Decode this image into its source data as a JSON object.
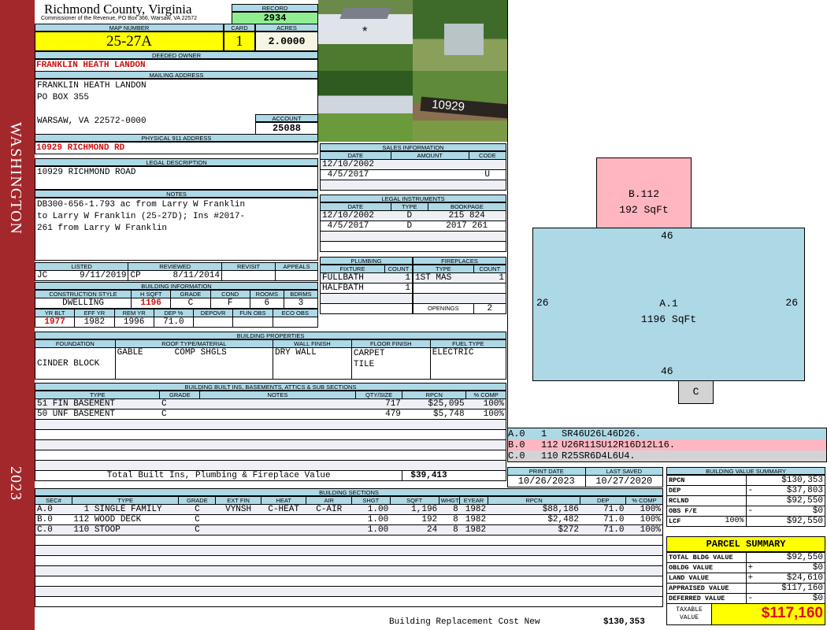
{
  "sidebar": {
    "district": "WASHINGTON",
    "year": "2023"
  },
  "header": {
    "title": "Richmond County, Virginia",
    "subtitle": "Commissioner of the Revenue, PO Box 366, Warsaw, VA 22572",
    "record_label": "RECORD",
    "record": "2934",
    "map_label": "MAP NUMBER",
    "map_number": "25-27A",
    "card_label": "CARD",
    "card": "1",
    "acres_label": "ACRES",
    "acres": "2.0000"
  },
  "owner": {
    "label": "DEEDED OWNER",
    "name": "FRANKLIN HEATH LANDON"
  },
  "mailing": {
    "label": "MAILING ADDRESS",
    "line1": "FRANKLIN HEATH LANDON",
    "line2": "PO BOX 355",
    "line3": "WARSAW, VA 22572-0000",
    "account_label": "ACCOUNT",
    "account": "25088"
  },
  "physical": {
    "label": "PHYSICAL 911 ADDRESS",
    "address": "10929 RICHMOND RD"
  },
  "legal": {
    "label": "LEGAL DESCRIPTION",
    "text": "10929 RICHMOND ROAD"
  },
  "notes": {
    "label": "NOTES",
    "text": "DB300-656-1.793 ac from Larry W Franklin\nto Larry W Franklin (25-27D); Ins #2017-\n261 from Larry W Franklin"
  },
  "photos": {
    "address_sign": "10929"
  },
  "sales": {
    "label": "SALES INFORMATION",
    "headers": [
      "DATE",
      "AMOUNT",
      "CODE"
    ],
    "rows": [
      [
        "12/10/2002",
        "",
        ""
      ],
      [
        " 4/5/2017",
        "",
        "U"
      ],
      [
        "",
        "",
        ""
      ]
    ]
  },
  "instruments": {
    "label": "LEGAL INSTRUMENTS",
    "headers": [
      "DATE",
      "TYPE",
      "BOOKPAGE"
    ],
    "rows": [
      [
        "12/10/2002",
        "D",
        "215 824"
      ],
      [
        " 4/5/2017",
        "D",
        "2017 261"
      ],
      [
        "",
        "",
        ""
      ],
      [
        "",
        "",
        ""
      ]
    ]
  },
  "review": {
    "headers": [
      "LISTED",
      "REVIEWED",
      "REVISIT",
      "APPEALS"
    ],
    "listed_by": "JC",
    "listed": "9/11/2019",
    "reviewed_by": "CP",
    "reviewed": "8/11/2014",
    "revisit": "",
    "appeals": ""
  },
  "building_info": {
    "label": "BUILDING INFORMATION",
    "headers1": [
      "CONSTRUCTION STYLE",
      "H SQFT",
      "GRADE",
      "COND",
      "ROOMS",
      "BDRMS"
    ],
    "row1": [
      "DWELLING",
      "1196",
      "C",
      "F",
      "6",
      "3"
    ],
    "headers2": [
      "YR BLT",
      "EFF YR",
      "REM YR",
      "DEP %",
      "DEPOVR",
      "FUN OBS",
      "ECO OBS"
    ],
    "row2": [
      "1977",
      "1982",
      "1996",
      "71.0",
      "",
      "",
      ""
    ]
  },
  "plumbing": {
    "label": "PLUMBING",
    "headers": [
      "FIXTURE",
      "COUNT"
    ],
    "rows": [
      [
        "FULLBATH",
        "1"
      ],
      [
        "HALFBATH",
        "1"
      ],
      [
        "",
        ""
      ],
      [
        "",
        ""
      ]
    ]
  },
  "fireplaces": {
    "label": "FIREPLACES",
    "headers": [
      "TYPE",
      "COUNT"
    ],
    "rows": [
      [
        "1ST MAS",
        "1"
      ],
      [
        "",
        ""
      ],
      [
        "",
        ""
      ]
    ],
    "openings_label": "OPENINGS",
    "openings": "2"
  },
  "properties": {
    "label": "BUILDING PROPERTIES",
    "headers": [
      "FOUNDATION",
      "ROOF TYPE/MATERIAL",
      "WALL FINISH",
      "FLOOR FINISH",
      "FUEL TYPE"
    ],
    "foundation": "CINDER BLOCK",
    "roof_type": "GABLE",
    "roof_material": "COMP SHGLS",
    "wall": "DRY WALL",
    "floor": "CARPET\nTILE",
    "fuel": "ELECTRIC"
  },
  "builtins": {
    "label": "BUILDING BUILT INS, BASEMENTS, ATTICS & SUB SECTIONS",
    "headers": [
      "TYPE",
      "GRADE",
      "NOTES",
      "QTY/SIZE",
      "RPCN",
      "% COMP"
    ],
    "rows": [
      [
        "51 FIN BASEMENT",
        "C",
        "",
        "717",
        "$25,095",
        "100%"
      ],
      [
        "50 UNF BASEMENT",
        "C",
        "",
        "479",
        "$5,748",
        "100%"
      ],
      [
        "",
        "",
        "",
        "",
        "",
        ""
      ],
      [
        "",
        "",
        "",
        "",
        "",
        ""
      ],
      [
        "",
        "",
        "",
        "",
        "",
        ""
      ],
      [
        "",
        "",
        "",
        "",
        "",
        ""
      ],
      [
        "",
        "",
        "",
        "",
        "",
        ""
      ]
    ],
    "total_label": "Total Built Ins, Plumbing & Fireplace Value",
    "total": "$39,413"
  },
  "sections": {
    "label": "BUILDING SECTIONS",
    "headers": [
      "SEC#",
      "TYPE",
      "GRADE",
      "EXT FIN",
      "HEAT",
      "AIR",
      "SHGT",
      "SQFT",
      "WHGT",
      "EYEAR",
      "RPCN",
      "DEP",
      "% COMP"
    ],
    "rows": [
      [
        "A.0",
        "  1 SINGLE FAMILY",
        "C",
        "VYNSH",
        "C-HEAT",
        "C-AIR",
        "1.00",
        "1,196",
        "8",
        "1982",
        "$88,186",
        "71.0",
        "100%"
      ],
      [
        "B.0",
        "112 WOOD DECK",
        "C",
        "",
        "",
        "",
        "1.00",
        "192",
        "8",
        "1982",
        "$2,482",
        "71.0",
        "100%"
      ],
      [
        "C.0",
        "110 STOOP",
        "C",
        "",
        "",
        "",
        "1.00",
        "24",
        "8",
        "1982",
        "$272",
        "71.0",
        "100%"
      ],
      [
        "",
        "",
        "",
        "",
        "",
        "",
        "",
        "",
        "",
        "",
        "",
        "",
        ""
      ],
      [
        "",
        "",
        "",
        "",
        "",
        "",
        "",
        "",
        "",
        "",
        "",
        "",
        ""
      ],
      [
        "",
        "",
        "",
        "",
        "",
        "",
        "",
        "",
        "",
        "",
        "",
        "",
        ""
      ],
      [
        "",
        "",
        "",
        "",
        "",
        "",
        "",
        "",
        "",
        "",
        "",
        "",
        ""
      ],
      [
        "",
        "",
        "",
        "",
        "",
        "",
        "",
        "",
        "",
        "",
        "",
        "",
        ""
      ],
      [
        "",
        "",
        "",
        "",
        "",
        "",
        "",
        "",
        "",
        "",
        "",
        "",
        ""
      ],
      [
        "",
        "",
        "",
        "",
        "",
        "",
        "",
        "",
        "",
        "",
        "",
        "",
        ""
      ]
    ],
    "total_label": "Building Replacement Cost New",
    "total": "$130,353"
  },
  "sketch": {
    "a_label": "A.1",
    "a_area": "1196 SqFt",
    "a_top": "46",
    "a_bottom": "46",
    "a_left": "26",
    "a_right": "26",
    "b_label": "B.112",
    "b_area": "192 SqFt",
    "c_label": "C",
    "colors": {
      "a": "#add8e6",
      "b": "#ffb6c1",
      "c": "#d3d3d3"
    }
  },
  "sketch_legend": [
    {
      "sec": "A.0",
      "code": "1",
      "path": "SR46U26L46D26."
    },
    {
      "sec": "B.0",
      "code": "112",
      "path": "U26R11SU12R16D12L16."
    },
    {
      "sec": "C.0",
      "code": "110",
      "path": "R25SR6D4L6U4."
    }
  ],
  "dates": {
    "print_label": "PRINT DATE",
    "print": "10/26/2023",
    "saved_label": "LAST SAVED",
    "saved": "10/27/2020"
  },
  "bvs": {
    "label": "BUILDING VALUE SUMMARY",
    "rows": [
      {
        "name": "RPCN",
        "sign": "",
        "value": "$130,353"
      },
      {
        "name": "DEP",
        "sign": "-",
        "value": "$37,803"
      },
      {
        "name": "RCLND",
        "sign": "",
        "value": "$92,550"
      },
      {
        "name": "OBS F/E",
        "sign": "-",
        "value": "$0"
      },
      {
        "name": "LCF",
        "pct": "100%",
        "sign": "",
        "value": "$92,550"
      }
    ]
  },
  "parcel": {
    "label": "PARCEL SUMMARY",
    "rows": [
      {
        "name": "TOTAL BLDG VALUE",
        "sign": "",
        "value": "$92,550"
      },
      {
        "name": "OBLDG VALUE",
        "sign": "+",
        "value": "$0"
      },
      {
        "name": "LAND VALUE",
        "sign": "+",
        "value": "$24,610"
      },
      {
        "name": "APPRAISED VALUE",
        "sign": "",
        "value": "$117,160"
      },
      {
        "name": "DEFERRED VALUE",
        "sign": "-",
        "value": "$0"
      }
    ],
    "taxable_label": "TAXABLE\nVALUE",
    "taxable": "$117,160"
  }
}
